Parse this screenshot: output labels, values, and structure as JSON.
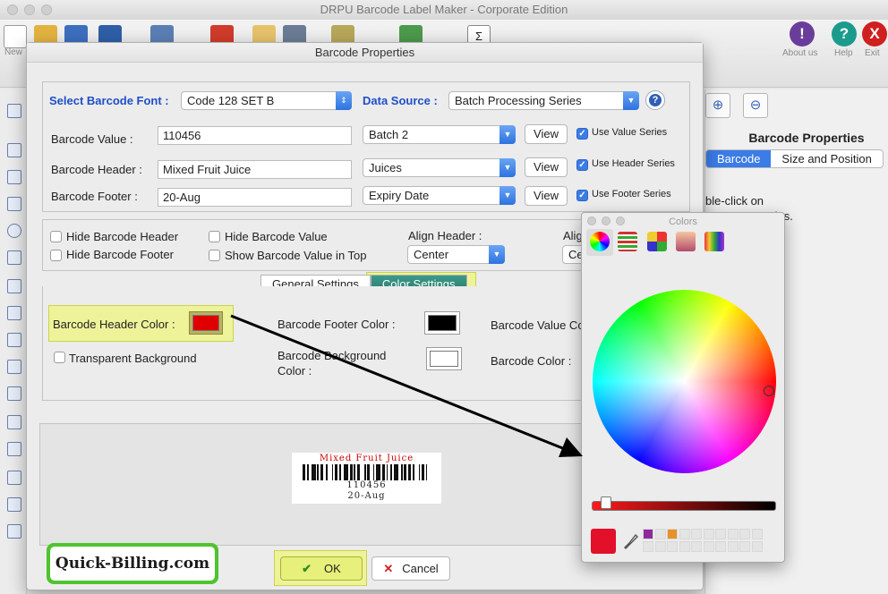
{
  "app": {
    "title": "DRPU Barcode Label Maker - Corporate Edition",
    "toolbar_left": [
      {
        "label": "New"
      }
    ],
    "toolbar_right": [
      {
        "label": "About us",
        "icon": "info-icon",
        "color": "#6b3d9a",
        "glyph": "!"
      },
      {
        "label": "Help",
        "icon": "help-icon",
        "color": "#1b9b8c",
        "glyph": "?"
      },
      {
        "label": "Exit",
        "icon": "exit-icon",
        "color": "#d01f1f",
        "glyph": "X"
      }
    ]
  },
  "right_panel": {
    "title": "Barcode Properties",
    "tabs": [
      {
        "label": "Barcode",
        "active": true
      },
      {
        "label": "Size and Position",
        "active": false
      }
    ],
    "hint_line1": "ble-click on",
    "hint_line2": "operties."
  },
  "dialog": {
    "title": "Barcode Properties",
    "font_label": "Select Barcode Font :",
    "font_value": "Code 128 SET B",
    "source_label": "Data Source :",
    "source_value": "Batch Processing Series",
    "rows": [
      {
        "label": "Barcode Value :",
        "value": "110456",
        "series": "Batch 2",
        "button": "View",
        "check_label": "Use Value Series"
      },
      {
        "label": "Barcode Header :",
        "value": "Mixed Fruit Juice",
        "series": "Juices",
        "button": "View",
        "check_label": "Use Header Series"
      },
      {
        "label": "Barcode Footer :",
        "value": "20-Aug",
        "series": "Expiry Date",
        "button": "View",
        "check_label": "Use Footer Series"
      }
    ],
    "options": {
      "hide_header": "Hide Barcode Header",
      "hide_footer": "Hide Barcode Footer",
      "hide_value": "Hide Barcode Value",
      "value_top": "Show Barcode Value in Top",
      "align_header_label": "Align Header :",
      "align_header_value": "Center",
      "align_footer_label_partial": "Alig",
      "align_footer_value_partial": "Cen"
    },
    "tabs": [
      {
        "label": "General Settings",
        "active": false
      },
      {
        "label": "Color Settings",
        "active": true
      }
    ],
    "colors": {
      "header_label": "Barcode Header Color :",
      "header_color": "#e00000",
      "footer_label": "Barcode Footer Color :",
      "footer_color": "#000000",
      "value_label_partial": "Barcode Value Co",
      "transparent": "Transparent Background",
      "background_label_1": "Barcode Background",
      "background_label_2": "Color :",
      "background_color": "#ffffff",
      "barcode_color_label": "Barcode Color :"
    },
    "preview": {
      "header": "Mixed Fruit Juice",
      "value": "110456",
      "footer": "20-Aug"
    },
    "watermark": "Quick-Billing.com",
    "ok": "OK",
    "cancel": "Cancel"
  },
  "colors_panel": {
    "title": "Colors",
    "current_color": "#e3102a",
    "swatches": [
      "#8e2a9e",
      "#e8912a"
    ]
  }
}
